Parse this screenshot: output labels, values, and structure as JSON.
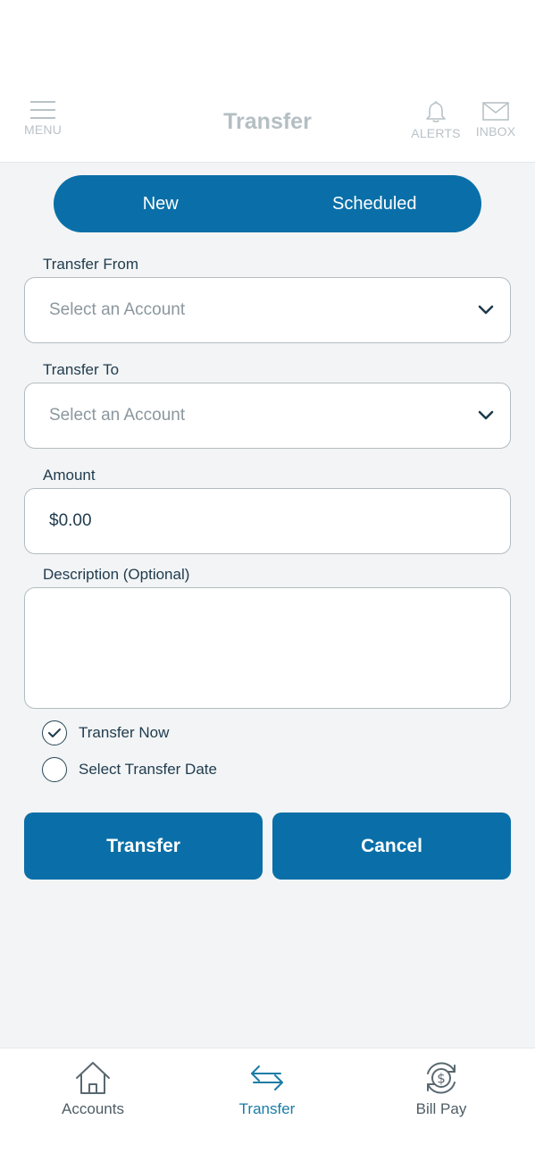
{
  "header": {
    "title": "Transfer",
    "menu_label": "MENU",
    "alerts_label": "ALERTS",
    "inbox_label": "INBOX"
  },
  "tabs": {
    "new_label": "New",
    "scheduled_label": "Scheduled"
  },
  "form": {
    "from_label": "Transfer From",
    "from_placeholder": "Select an Account",
    "to_label": "Transfer To",
    "to_placeholder": "Select an Account",
    "amount_label": "Amount",
    "amount_value": "$0.00",
    "description_label": "Description (Optional)",
    "description_value": "",
    "option_now_label": "Transfer Now",
    "option_date_label": "Select Transfer Date",
    "option_now_selected": true
  },
  "actions": {
    "transfer_label": "Transfer",
    "cancel_label": "Cancel"
  },
  "bottom_nav": {
    "accounts_label": "Accounts",
    "transfer_label": "Transfer",
    "billpay_label": "Bill Pay"
  },
  "colors": {
    "accent": "#0a6fa8",
    "active_tab": "#1a7ca6",
    "background": "#f2f4f5"
  }
}
